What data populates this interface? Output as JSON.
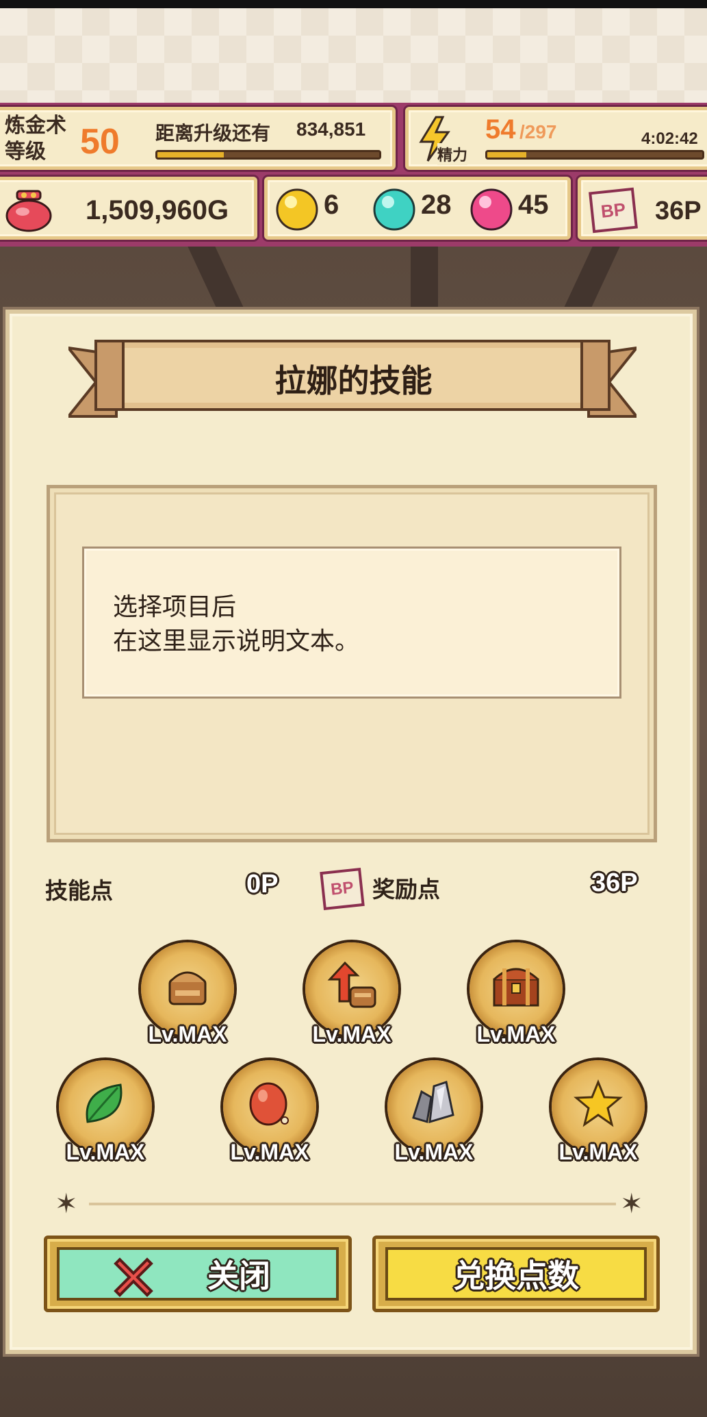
{
  "hud": {
    "alchemy_level_label": "炼金术\n等级",
    "alchemy_level_value": "50",
    "exp_to_next_label": "距离升级还有",
    "exp_to_next_value": "834,851",
    "exp_progress_pct": 30,
    "stamina_label": "精力",
    "stamina_current": "54",
    "stamina_max": "/297",
    "stamina_progress_pct": 18,
    "stamina_timer": "4:02:42",
    "gold": "1,509,960G",
    "gem_yellow": "6",
    "gem_cyan": "28",
    "gem_pink": "45",
    "bp_badge": "BP",
    "bp_points": "36P"
  },
  "dialog": {
    "title": "拉娜的技能",
    "description_line1": "选择项目后",
    "description_line2": "在这里显示说明文本。",
    "skill_points_label": "技能点",
    "skill_points_value": "0P",
    "bonus_points_badge": "BP",
    "bonus_points_label": "奖励点",
    "bonus_points_value": "36P",
    "skills": [
      {
        "icon": "bread-icon",
        "level": "Lv.MAX"
      },
      {
        "icon": "arrow-up-items-icon",
        "level": "Lv.MAX"
      },
      {
        "icon": "treasure-chest-icon",
        "level": "Lv.MAX"
      },
      {
        "icon": "leaf-icon",
        "level": "Lv.MAX"
      },
      {
        "icon": "red-fruit-icon",
        "level": "Lv.MAX"
      },
      {
        "icon": "ore-crystal-icon",
        "level": "Lv.MAX"
      },
      {
        "icon": "star-icon",
        "level": "Lv.MAX"
      }
    ],
    "close_button": "关闭",
    "exchange_button": "兑换点数"
  },
  "colors": {
    "accent_orange": "#ef7b2c",
    "hud_magenta": "#9c3b69",
    "close_green": "#8fe6bf",
    "exchange_yellow": "#f7dc44"
  }
}
